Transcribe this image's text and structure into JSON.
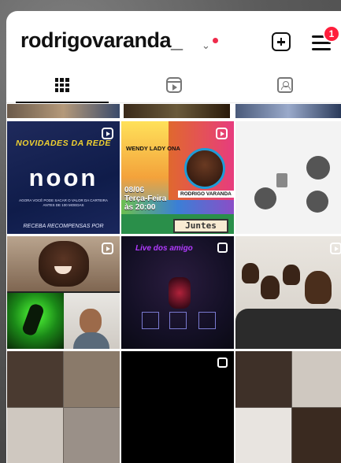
{
  "header": {
    "username": "rodrigovaranda_",
    "dropdown_glyph": "⌄",
    "notification_badge": "1",
    "icons": [
      "add-post-icon",
      "hamburger-menu-icon",
      "chevron-down-icon"
    ]
  },
  "tabs": [
    {
      "name": "grid",
      "icon": "grid-icon",
      "active": true
    },
    {
      "name": "reels",
      "icon": "reels-icon",
      "active": false
    },
    {
      "name": "tagged",
      "icon": "tagged-icon",
      "active": false
    }
  ],
  "posts": {
    "noon": {
      "title": "NOVIDADES DA REDE",
      "logo": "noon",
      "body": "AGORA VOCÊ PODE SACAR O VALOR DA CARTEIRA ANTES DE 100 MOEDAS",
      "footer": "RECEBA RECOMPENSAS POR"
    },
    "event": {
      "guest": "WENDY LADY ONA",
      "host": "RODRIGO VARANDA",
      "date_line1": "08/06",
      "date_line2": "Terça-Feira",
      "date_line3": "às 20:00",
      "brand": "Juntes"
    },
    "live": {
      "title": "Live dos amigo"
    }
  },
  "colors": {
    "badge": "#ff1e3c",
    "live_dot": "#ef2b4b",
    "noon_bg": "#1f2a5c",
    "noon_title": "#f1d230"
  }
}
